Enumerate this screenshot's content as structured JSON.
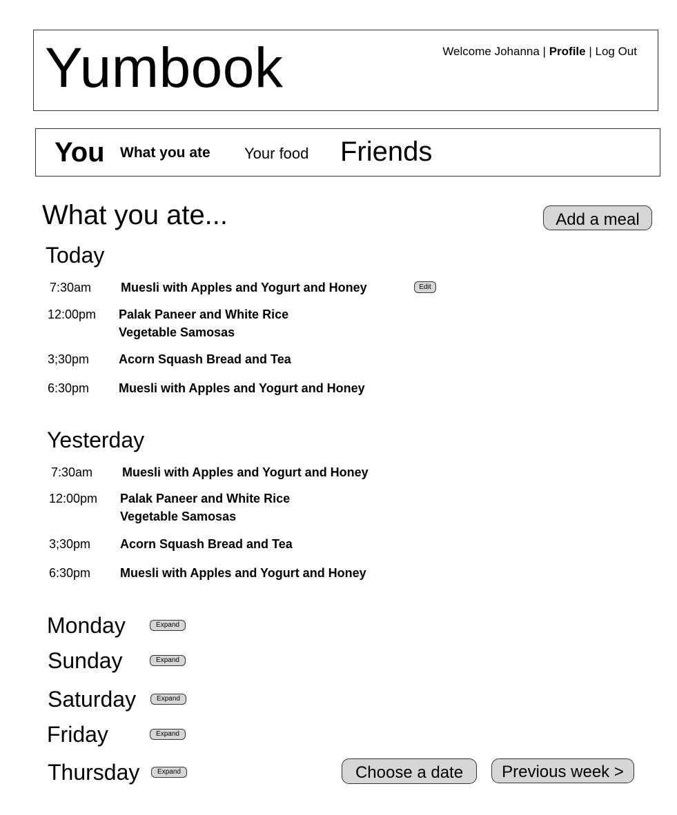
{
  "header": {
    "logo": "Yumbook",
    "welcome": "Welcome Johanna",
    "separator": "|",
    "profile": "Profile",
    "logout": "Log Out"
  },
  "nav": {
    "you": "You",
    "what_you_ate": "What you ate",
    "your_food": "Your food",
    "friends": "Friends"
  },
  "main": {
    "title": "What you ate...",
    "add_meal": "Add a meal",
    "edit_label": "Edit",
    "expand_label": "Expand",
    "today": {
      "label": "Today",
      "meals": [
        {
          "time": "7:30am",
          "items": [
            "Muesli with Apples and Yogurt and Honey"
          ]
        },
        {
          "time": "12:00pm",
          "items": [
            "Palak Paneer and White Rice",
            "Vegetable Samosas"
          ]
        },
        {
          "time": "3;30pm",
          "items": [
            "Acorn Squash Bread and Tea"
          ]
        },
        {
          "time": "6:30pm",
          "items": [
            "Muesli with Apples and Yogurt and Honey"
          ]
        }
      ]
    },
    "yesterday": {
      "label": "Yesterday",
      "meals": [
        {
          "time": "7:30am",
          "items": [
            "Muesli with Apples and Yogurt and Honey"
          ]
        },
        {
          "time": "12:00pm",
          "items": [
            "Palak Paneer and White Rice",
            "Vegetable Samosas"
          ]
        },
        {
          "time": "3;30pm",
          "items": [
            "Acorn Squash Bread and Tea"
          ]
        },
        {
          "time": "6:30pm",
          "items": [
            "Muesli with Apples and Yogurt and Honey"
          ]
        }
      ]
    },
    "collapsed_days": [
      "Monday",
      "Sunday",
      "Saturday",
      "Friday",
      "Thursday"
    ],
    "choose_date": "Choose a date",
    "previous_week": "Previous week >"
  }
}
